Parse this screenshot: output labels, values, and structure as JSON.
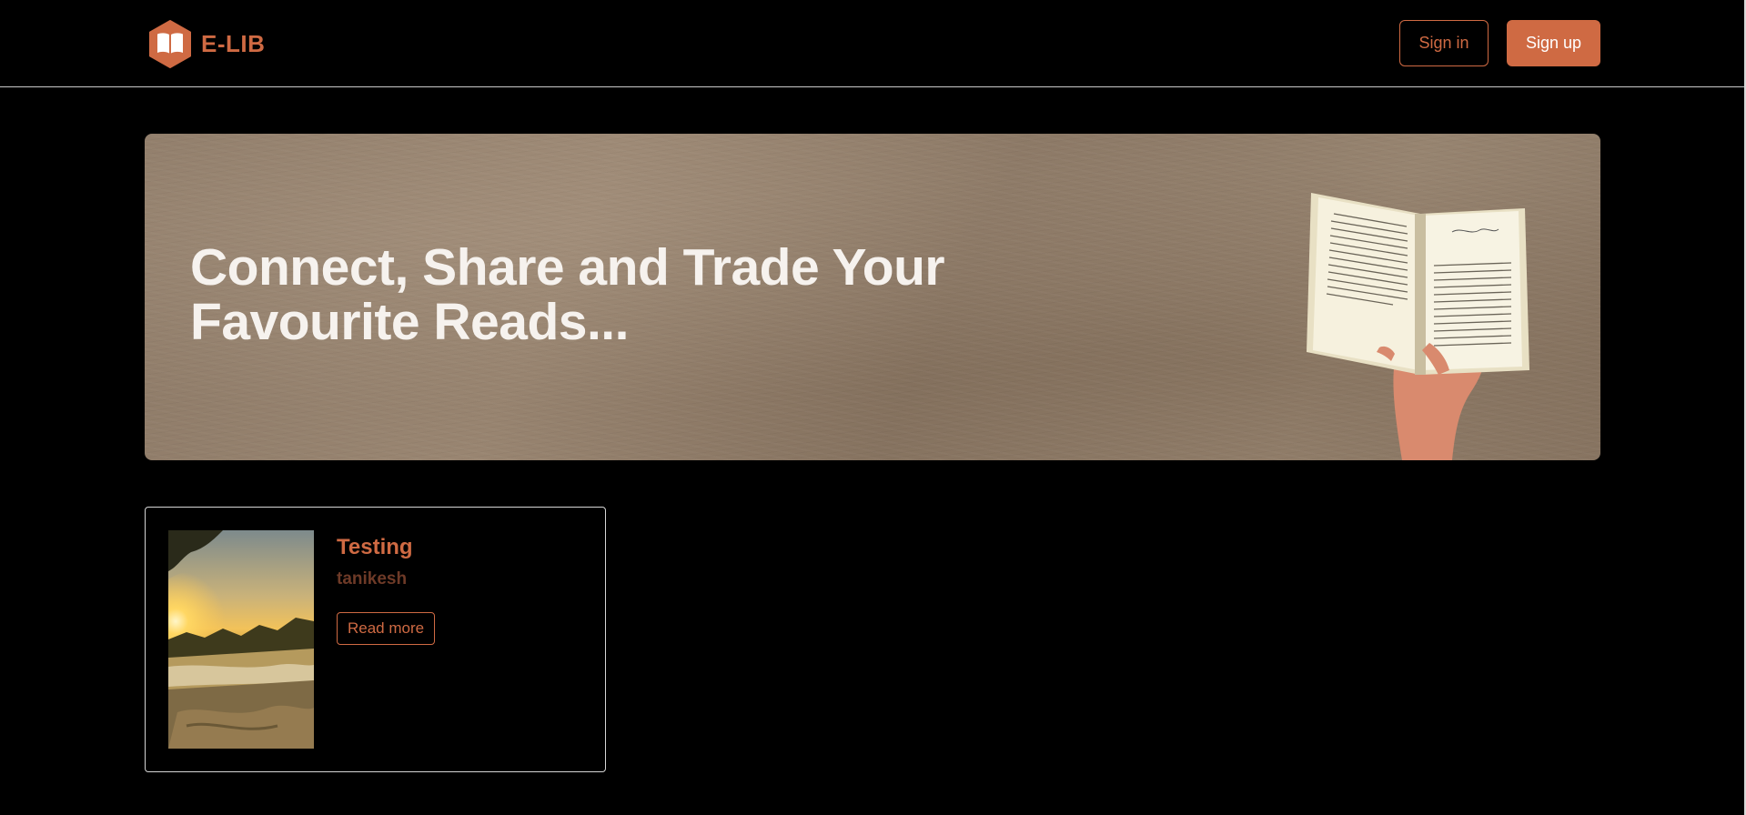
{
  "header": {
    "brand_name": "E-LIB",
    "signin_label": "Sign in",
    "signup_label": "Sign up",
    "logo_icon": "book-hexagon-icon"
  },
  "hero": {
    "title": "Connect, Share and Trade Your Favourite Reads...",
    "image": "open-book-in-hand-image"
  },
  "books": [
    {
      "title": "Testing",
      "author": "tanikesh",
      "read_more_label": "Read more",
      "cover": "sunset-river-cover-image"
    }
  ],
  "colors": {
    "accent": "#cf6a43",
    "author": "#6e3a27",
    "background": "#000000",
    "border": "#d6d6d6"
  }
}
